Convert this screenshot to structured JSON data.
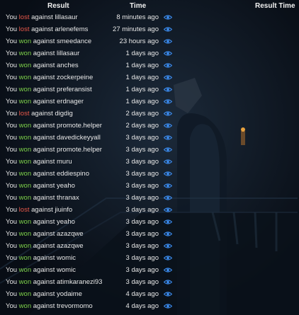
{
  "header": {
    "result": "Result",
    "time": "Time",
    "result_time": "Result Time"
  },
  "theme": {
    "won_color": "#7ed34a",
    "lost_color": "#e8584a",
    "eye_color": "#3b8cf0"
  },
  "games": [
    {
      "prefix": "You",
      "outcome": "lost",
      "against": "against lillasaur",
      "time": "8 minutes ago",
      "icon": "eye-icon"
    },
    {
      "prefix": "You",
      "outcome": "lost",
      "against": "against arlenefems",
      "time": "27 minutes ago",
      "icon": "eye-icon"
    },
    {
      "prefix": "You",
      "outcome": "won",
      "against": "against smeedance",
      "time": "23 hours ago",
      "icon": "eye-icon"
    },
    {
      "prefix": "You",
      "outcome": "won",
      "against": "against lillasaur",
      "time": "1 days ago",
      "icon": "eye-icon"
    },
    {
      "prefix": "You",
      "outcome": "won",
      "against": "against anches",
      "time": "1 days ago",
      "icon": "eye-icon"
    },
    {
      "prefix": "You",
      "outcome": "won",
      "against": "against zockerpeine",
      "time": "1 days ago",
      "icon": "eye-icon"
    },
    {
      "prefix": "You",
      "outcome": "won",
      "against": "against preferansist",
      "time": "1 days ago",
      "icon": "eye-icon"
    },
    {
      "prefix": "You",
      "outcome": "won",
      "against": "against erdnager",
      "time": "1 days ago",
      "icon": "eye-icon"
    },
    {
      "prefix": "You",
      "outcome": "lost",
      "against": "against digdig",
      "time": "2 days ago",
      "icon": "eye-icon"
    },
    {
      "prefix": "You",
      "outcome": "won",
      "against": "against promote.helper",
      "time": "2 days ago",
      "icon": "eye-icon"
    },
    {
      "prefix": "You",
      "outcome": "won",
      "against": "against davedickeyyall",
      "time": "3 days ago",
      "icon": "eye-icon"
    },
    {
      "prefix": "You",
      "outcome": "won",
      "against": "against promote.helper",
      "time": "3 days ago",
      "icon": "eye-icon"
    },
    {
      "prefix": "You",
      "outcome": "won",
      "against": "against muru",
      "time": "3 days ago",
      "icon": "eye-icon"
    },
    {
      "prefix": "You",
      "outcome": "won",
      "against": "against eddiespino",
      "time": "3 days ago",
      "icon": "eye-icon"
    },
    {
      "prefix": "You",
      "outcome": "won",
      "against": "against yeaho",
      "time": "3 days ago",
      "icon": "eye-icon"
    },
    {
      "prefix": "You",
      "outcome": "won",
      "against": "against thranax",
      "time": "3 days ago",
      "icon": "eye-icon"
    },
    {
      "prefix": "You",
      "outcome": "lost",
      "against": "against jiuinfo",
      "time": "3 days ago",
      "icon": "eye-icon"
    },
    {
      "prefix": "You",
      "outcome": "won",
      "against": "against yeaho",
      "time": "3 days ago",
      "icon": "eye-icon"
    },
    {
      "prefix": "You",
      "outcome": "won",
      "against": "against azazqwe",
      "time": "3 days ago",
      "icon": "eye-icon"
    },
    {
      "prefix": "You",
      "outcome": "won",
      "against": "against azazqwe",
      "time": "3 days ago",
      "icon": "eye-icon"
    },
    {
      "prefix": "You",
      "outcome": "won",
      "against": "against womic",
      "time": "3 days ago",
      "icon": "eye-icon"
    },
    {
      "prefix": "You",
      "outcome": "won",
      "against": "against womic",
      "time": "3 days ago",
      "icon": "eye-icon"
    },
    {
      "prefix": "You",
      "outcome": "won",
      "against": "against atimkaranezi93",
      "time": "3 days ago",
      "icon": "eye-icon"
    },
    {
      "prefix": "You",
      "outcome": "won",
      "against": "against yodaime",
      "time": "4 days ago",
      "icon": "eye-icon"
    },
    {
      "prefix": "You",
      "outcome": "won",
      "against": "against trevormomo",
      "time": "4 days ago",
      "icon": "eye-icon"
    }
  ]
}
